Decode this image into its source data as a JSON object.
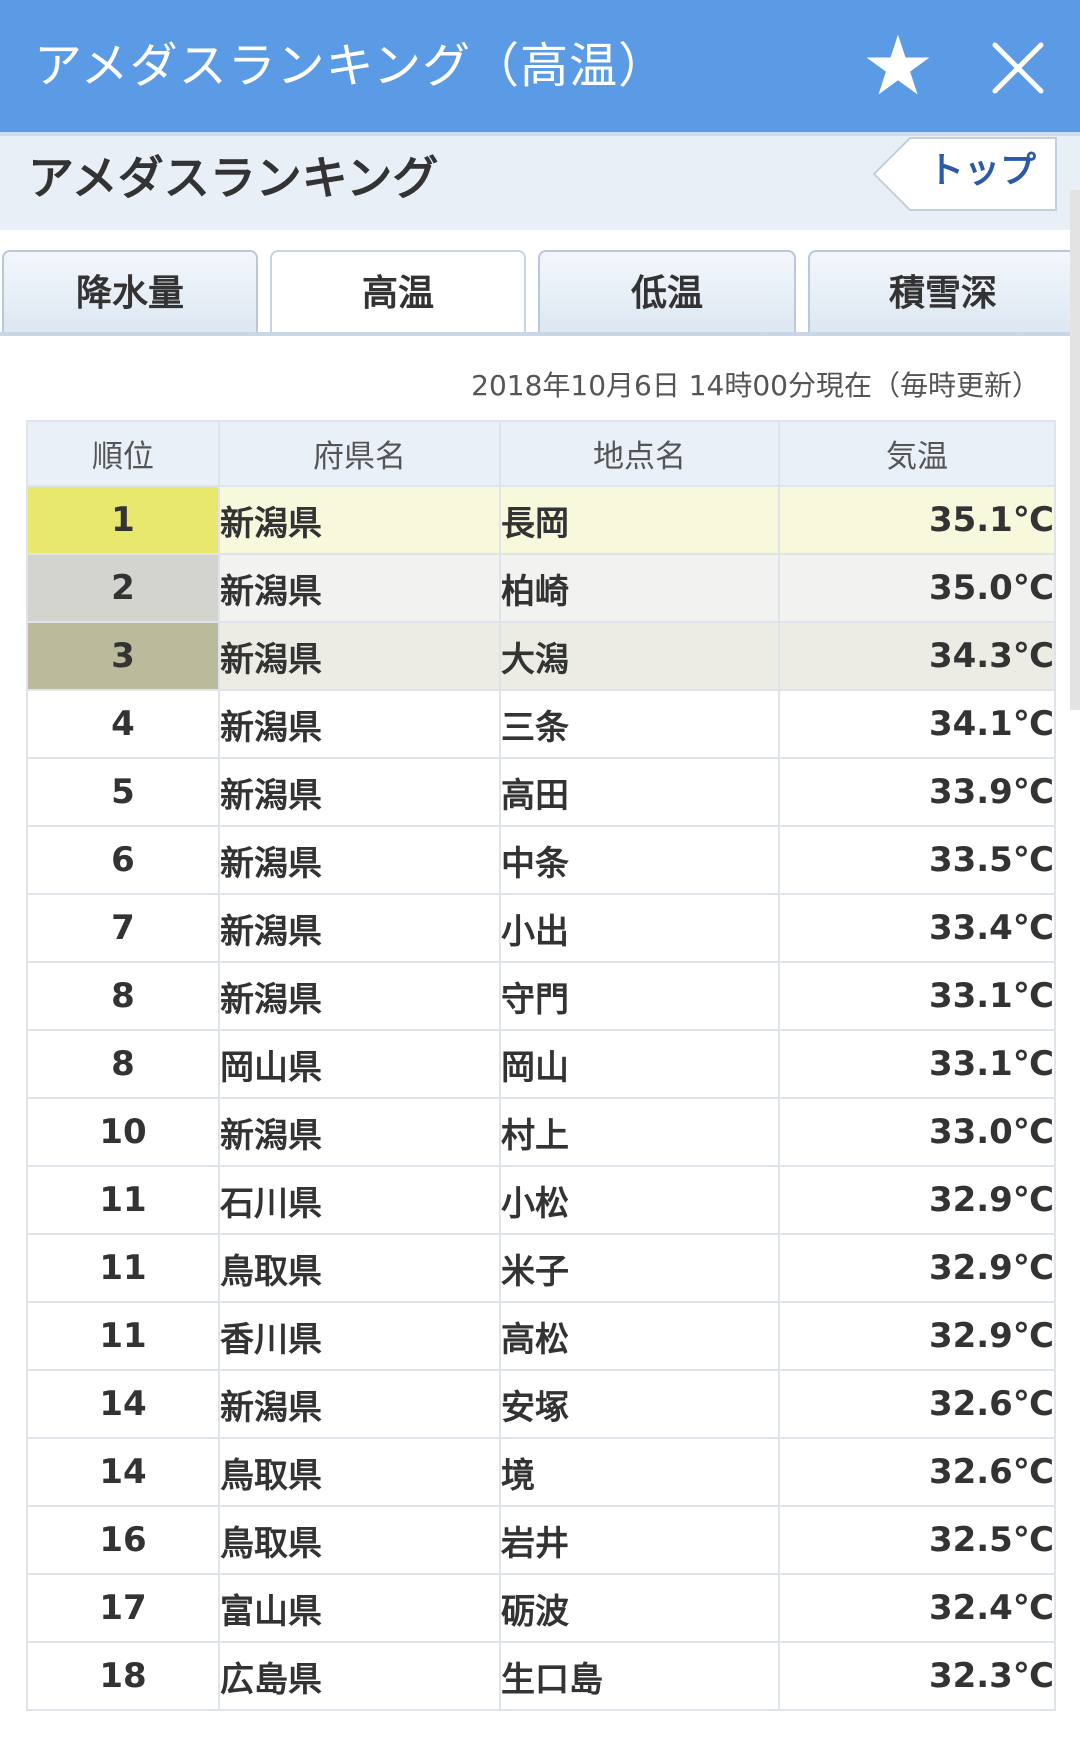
{
  "app": {
    "title": "アメダスランキング（高温）"
  },
  "subheader": {
    "heading": "アメダスランキング",
    "top_button": "トップ"
  },
  "tabs": [
    {
      "label": "降水量",
      "active": false
    },
    {
      "label": "高温",
      "active": true
    },
    {
      "label": "低温",
      "active": false
    },
    {
      "label": "積雪深",
      "active": false
    }
  ],
  "timestamp": "2018年10月6日 14時00分現在（毎時更新）",
  "table": {
    "headers": [
      "順位",
      "府県名",
      "地点名",
      "気温"
    ],
    "rows": [
      {
        "rank": "1",
        "pref": "新潟県",
        "point": "長岡",
        "temp": "35.1℃"
      },
      {
        "rank": "2",
        "pref": "新潟県",
        "point": "柏崎",
        "temp": "35.0℃"
      },
      {
        "rank": "3",
        "pref": "新潟県",
        "point": "大潟",
        "temp": "34.3℃"
      },
      {
        "rank": "4",
        "pref": "新潟県",
        "point": "三条",
        "temp": "34.1℃"
      },
      {
        "rank": "5",
        "pref": "新潟県",
        "point": "高田",
        "temp": "33.9℃"
      },
      {
        "rank": "6",
        "pref": "新潟県",
        "point": "中条",
        "temp": "33.5℃"
      },
      {
        "rank": "7",
        "pref": "新潟県",
        "point": "小出",
        "temp": "33.4℃"
      },
      {
        "rank": "8",
        "pref": "新潟県",
        "point": "守門",
        "temp": "33.1℃"
      },
      {
        "rank": "8",
        "pref": "岡山県",
        "point": "岡山",
        "temp": "33.1℃"
      },
      {
        "rank": "10",
        "pref": "新潟県",
        "point": "村上",
        "temp": "33.0℃"
      },
      {
        "rank": "11",
        "pref": "石川県",
        "point": "小松",
        "temp": "32.9℃"
      },
      {
        "rank": "11",
        "pref": "鳥取県",
        "point": "米子",
        "temp": "32.9℃"
      },
      {
        "rank": "11",
        "pref": "香川県",
        "point": "高松",
        "temp": "32.9℃"
      },
      {
        "rank": "14",
        "pref": "新潟県",
        "point": "安塚",
        "temp": "32.6℃"
      },
      {
        "rank": "14",
        "pref": "鳥取県",
        "point": "境",
        "temp": "32.6℃"
      },
      {
        "rank": "16",
        "pref": "鳥取県",
        "point": "岩井",
        "temp": "32.5℃"
      },
      {
        "rank": "17",
        "pref": "富山県",
        "point": "砺波",
        "temp": "32.4℃"
      },
      {
        "rank": "18",
        "pref": "広島県",
        "point": "生口島",
        "temp": "32.3℃"
      }
    ]
  },
  "icons": {
    "favorite": "star-icon",
    "close": "close-icon",
    "back": "arrow-left-icon"
  },
  "colors": {
    "header_bg": "#5b9be6",
    "link": "#2b5aa8",
    "rank1": "#e7e86d",
    "rank2": "#d4d4cf",
    "rank3": "#bbbb9b"
  }
}
